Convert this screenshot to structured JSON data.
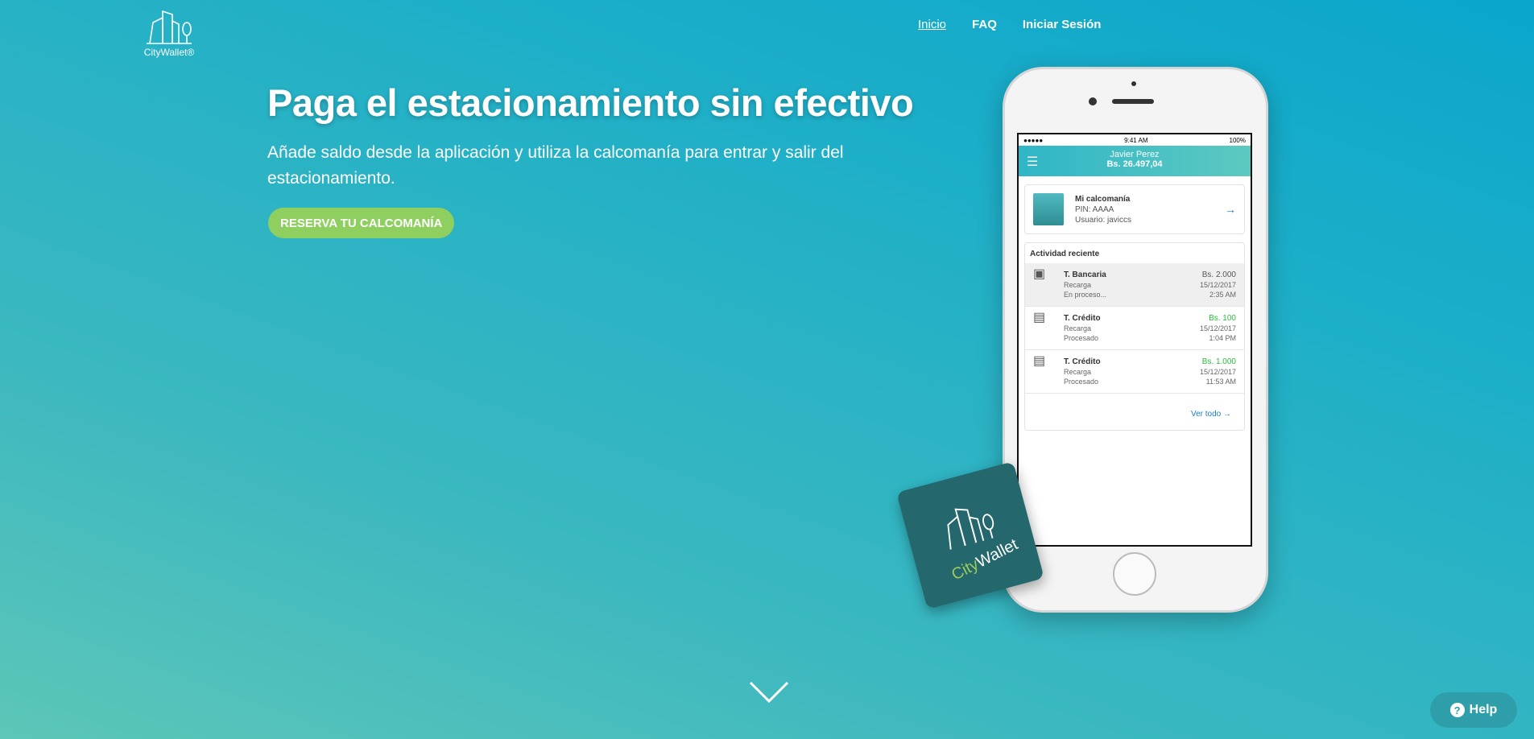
{
  "logo": {
    "text": "CityWallet®"
  },
  "nav": {
    "items": [
      {
        "label": "Inicio",
        "active": true
      },
      {
        "label": "FAQ"
      },
      {
        "label": "Iniciar Sesión"
      }
    ]
  },
  "hero": {
    "title": "Paga el estacionamiento sin efectivo",
    "subtitle": "Añade saldo desde la aplicación y utiliza la calcomanía para entrar y salir del estacionamiento.",
    "cta_label": "RESERVA TU CALCOMANÍA"
  },
  "phone": {
    "status": {
      "left": "●●●●●",
      "time": "9:41 AM",
      "battery": "100%"
    },
    "user_name": "Javier Perez",
    "balance": "Bs. 26.497,04",
    "card": {
      "title": "Mi calcomanía",
      "pin": "PIN: AAAA",
      "user": "Usuario: javiccs"
    },
    "activity_title": "Actividad reciente",
    "activity": [
      {
        "name": "T. Bancaria",
        "type": "Recarga",
        "status": "En proceso...",
        "amount": "Bs. 2.000",
        "date": "15/12/2017",
        "time": "2:35 AM"
      },
      {
        "name": "T. Crédito",
        "type": "Recarga",
        "status": "Procesado",
        "amount": "Bs. 100",
        "date": "15/12/2017",
        "time": "1:04 PM"
      },
      {
        "name": "T. Crédito",
        "type": "Recarga",
        "status": "Procesado",
        "amount": "Bs. 1.000",
        "date": "15/12/2017",
        "time": "11:53 AM"
      }
    ],
    "view_all": "Ver todo"
  },
  "sticker": {
    "city": "City",
    "wallet": "Wallet"
  },
  "help": {
    "label": "Help"
  },
  "colors": {
    "accent": "#8fcf5f",
    "link": "#1a7bd0",
    "positive": "#2bbb3e"
  }
}
